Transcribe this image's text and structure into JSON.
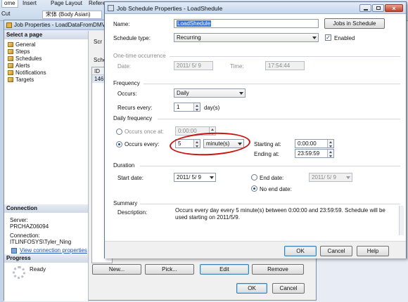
{
  "word_ribbon": {
    "tabs": [
      "ome",
      "Insert",
      "Page Layout",
      "Refere"
    ],
    "cut_label": "Cut",
    "font_box": "宋体 (Body Asian)"
  },
  "job_properties": {
    "title": "Job Properties - LoadDataFromDMV",
    "select_page_header": "Select a page",
    "pages": [
      "General",
      "Steps",
      "Schedules",
      "Alerts",
      "Notifications",
      "Targets"
    ],
    "connection_header": "Connection",
    "server_label": "Server:",
    "server_value": "PRCHAZ06094",
    "connection_label": "Connection:",
    "connection_value": "ITLINFOSYS\\Tyler_Ning",
    "view_link": "View connection properties",
    "progress_header": "Progress",
    "progress_status": "Ready",
    "toolbar_fragment": "Scr",
    "schedules_fragment": "Schedu",
    "grid_header": "ID",
    "grid_row_id": "146",
    "buttons": {
      "new": "New...",
      "pick": "Pick...",
      "edit": "Edit",
      "remove": "Remove",
      "ok": "OK",
      "cancel": "Cancel"
    }
  },
  "schedule_dialog": {
    "title": "Job Schedule Properties - LoadShedule",
    "name_label": "Name:",
    "name_value": "LoadShedule",
    "jobs_in_schedule": "Jobs in Schedule",
    "schedule_type_label": "Schedule type:",
    "schedule_type_value": "Recurring",
    "enabled_label": "Enabled",
    "one_time": {
      "title": "One-time occurrence",
      "date_label": "Date:",
      "date_value": "2011/ 5/ 9",
      "time_label": "Time:",
      "time_value": "17:54:44"
    },
    "frequency": {
      "title": "Frequency",
      "occurs_label": "Occurs:",
      "occurs_value": "Daily",
      "recurs_label": "Recurs every:",
      "recurs_value": "1",
      "recurs_unit": "day(s)"
    },
    "daily_frequency": {
      "title": "Daily frequency",
      "once_label": "Occurs once at:",
      "once_value": "0:00:00",
      "every_label": "Occurs every:",
      "every_value": "5",
      "every_unit": "minute(s)",
      "starting_label": "Starting at:",
      "starting_value": "0:00:00",
      "ending_label": "Ending at:",
      "ending_value": "23:59:59"
    },
    "duration": {
      "title": "Duration",
      "start_label": "Start date:",
      "start_value": "2011/ 5/ 9",
      "end_label": "End date:",
      "end_value": "2011/ 5/ 9",
      "no_end_label": "No end date:"
    },
    "summary": {
      "title": "Summary",
      "desc_label": "Description:",
      "desc_value": "Occurs every day every 5 minute(s) between 0:00:00 and 23:59:59. Schedule will be used starting on 2011/5/9."
    },
    "buttons": {
      "ok": "OK",
      "cancel": "Cancel",
      "help": "Help"
    }
  },
  "colors": {
    "highlight_circle": "#cc1111",
    "selection": "#3875d7",
    "title_bar": "#c9d9ee"
  }
}
